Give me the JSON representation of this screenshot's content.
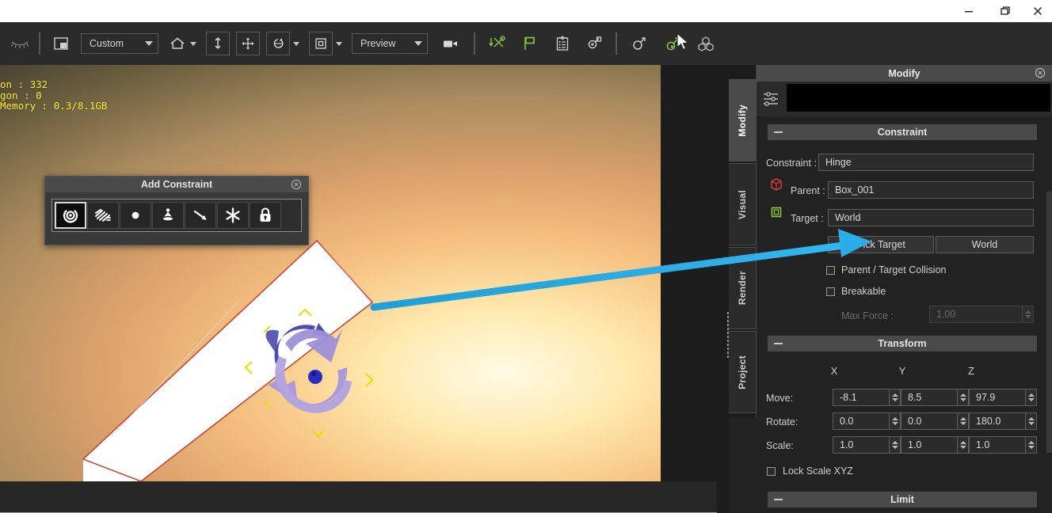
{
  "window": {
    "controls": [
      {
        "name": "minimize",
        "glyph": "minimize-icon"
      },
      {
        "name": "maximize",
        "glyph": "restore-icon"
      },
      {
        "name": "close",
        "glyph": "close-icon"
      }
    ]
  },
  "toolbar": {
    "eye_icon": "eyelash-closed-eye-icon",
    "layout_icon": "panel-layout-icon",
    "preset_combo": {
      "value": "Custom",
      "label": "Custom"
    },
    "home_icon": "home-icon",
    "drop_icon": "drop-to-floor-icon",
    "move_icon": "move-arrows-icon",
    "rotate_icon": "rotate-icon",
    "scale_icon": "scale-icon",
    "preview_combo": {
      "value": "Preview",
      "label": "Preview"
    },
    "camera_icon": "video-camera-icon",
    "physics_icon": "apply-physics-icon",
    "flag_icon": "flag-icon",
    "list_icon": "clipboard-list-icon",
    "zoom_object_icon": "zoom-object-icon",
    "male_icon": "character-rig-icon",
    "attach_icon": "attach-constraint-icon",
    "blocks_icon": "blocks-group-icon"
  },
  "viewport": {
    "stats_lines": [
      "on : 332",
      "gon : 0",
      "Memory : 0.3/8.1GB"
    ],
    "stats_color": "#ffeb3b"
  },
  "add_constraint": {
    "title": "Add Constraint",
    "close_icon": "close-circle-icon",
    "items": [
      {
        "name": "hinge-constraint",
        "icon": "hinge-icon",
        "selected": true
      },
      {
        "name": "spring-constraint",
        "icon": "spring-icon",
        "selected": false
      },
      {
        "name": "point-constraint",
        "icon": "point-ball-icon",
        "selected": false
      },
      {
        "name": "cone-constraint",
        "icon": "cone-twist-icon",
        "selected": false
      },
      {
        "name": "slider-constraint",
        "icon": "slider-arrow-icon",
        "selected": false
      },
      {
        "name": "fixed-constraint",
        "icon": "snowflake-fixed-icon",
        "selected": false
      },
      {
        "name": "lock-constraint",
        "icon": "padlock-icon",
        "selected": false
      }
    ]
  },
  "dock": {
    "tabs": [
      {
        "label": "Modify",
        "active": true
      },
      {
        "label": "Visual",
        "active": false
      },
      {
        "label": "Render",
        "active": false
      },
      {
        "label": "Project",
        "active": false
      }
    ],
    "panel_title": "Modify",
    "panel_close_icon": "close-circle-icon",
    "sliders_icon": "sliders-settings-icon",
    "header_field_value": ""
  },
  "constraint_section": {
    "title": "Constraint",
    "collapse_icon": "minus-collapse-icon",
    "constraint_label": "Constraint :",
    "constraint_value": "Hinge",
    "parent_icon": "red-box-icon",
    "parent_label": "Parent :",
    "parent_value": "Box_001",
    "target_icon": "green-box-icon",
    "target_label": "Target :",
    "target_value": "World",
    "pick_target_button": "Pick Target",
    "world_button": "World",
    "parent_target_collision_label": "Parent / Target Collision",
    "parent_target_collision_checked": false,
    "breakable_label": "Breakable",
    "breakable_checked": false,
    "max_force_label": "Max Force :",
    "max_force_value": "1.00",
    "max_force_disabled": true
  },
  "transform_section": {
    "title": "Transform",
    "collapse_icon": "minus-collapse-icon",
    "axes": [
      "X",
      "Y",
      "Z"
    ],
    "rows": [
      {
        "label": "Move:",
        "values": [
          "-8.1",
          "8.5",
          "97.9"
        ]
      },
      {
        "label": "Rotate:",
        "values": [
          "0.0",
          "0.0",
          "180.0"
        ]
      },
      {
        "label": "Scale:",
        "values": [
          "1.0",
          "1.0",
          "1.0"
        ]
      }
    ],
    "lock_scale_label": "Lock Scale XYZ",
    "lock_scale_checked": false
  },
  "limit_section": {
    "title": "Limit",
    "collapse_icon": "minus-collapse-icon"
  },
  "annotation": {
    "arrow_color": "#29ABE2",
    "arrow_target": "pick-target-button"
  },
  "colors": {
    "accent_green": "#8cc63f",
    "accent_red": "#cf3b3b",
    "panel_bg": "#222222",
    "header_bg": "#4a4a4a",
    "toolbar_bg": "#2b2b2b"
  }
}
